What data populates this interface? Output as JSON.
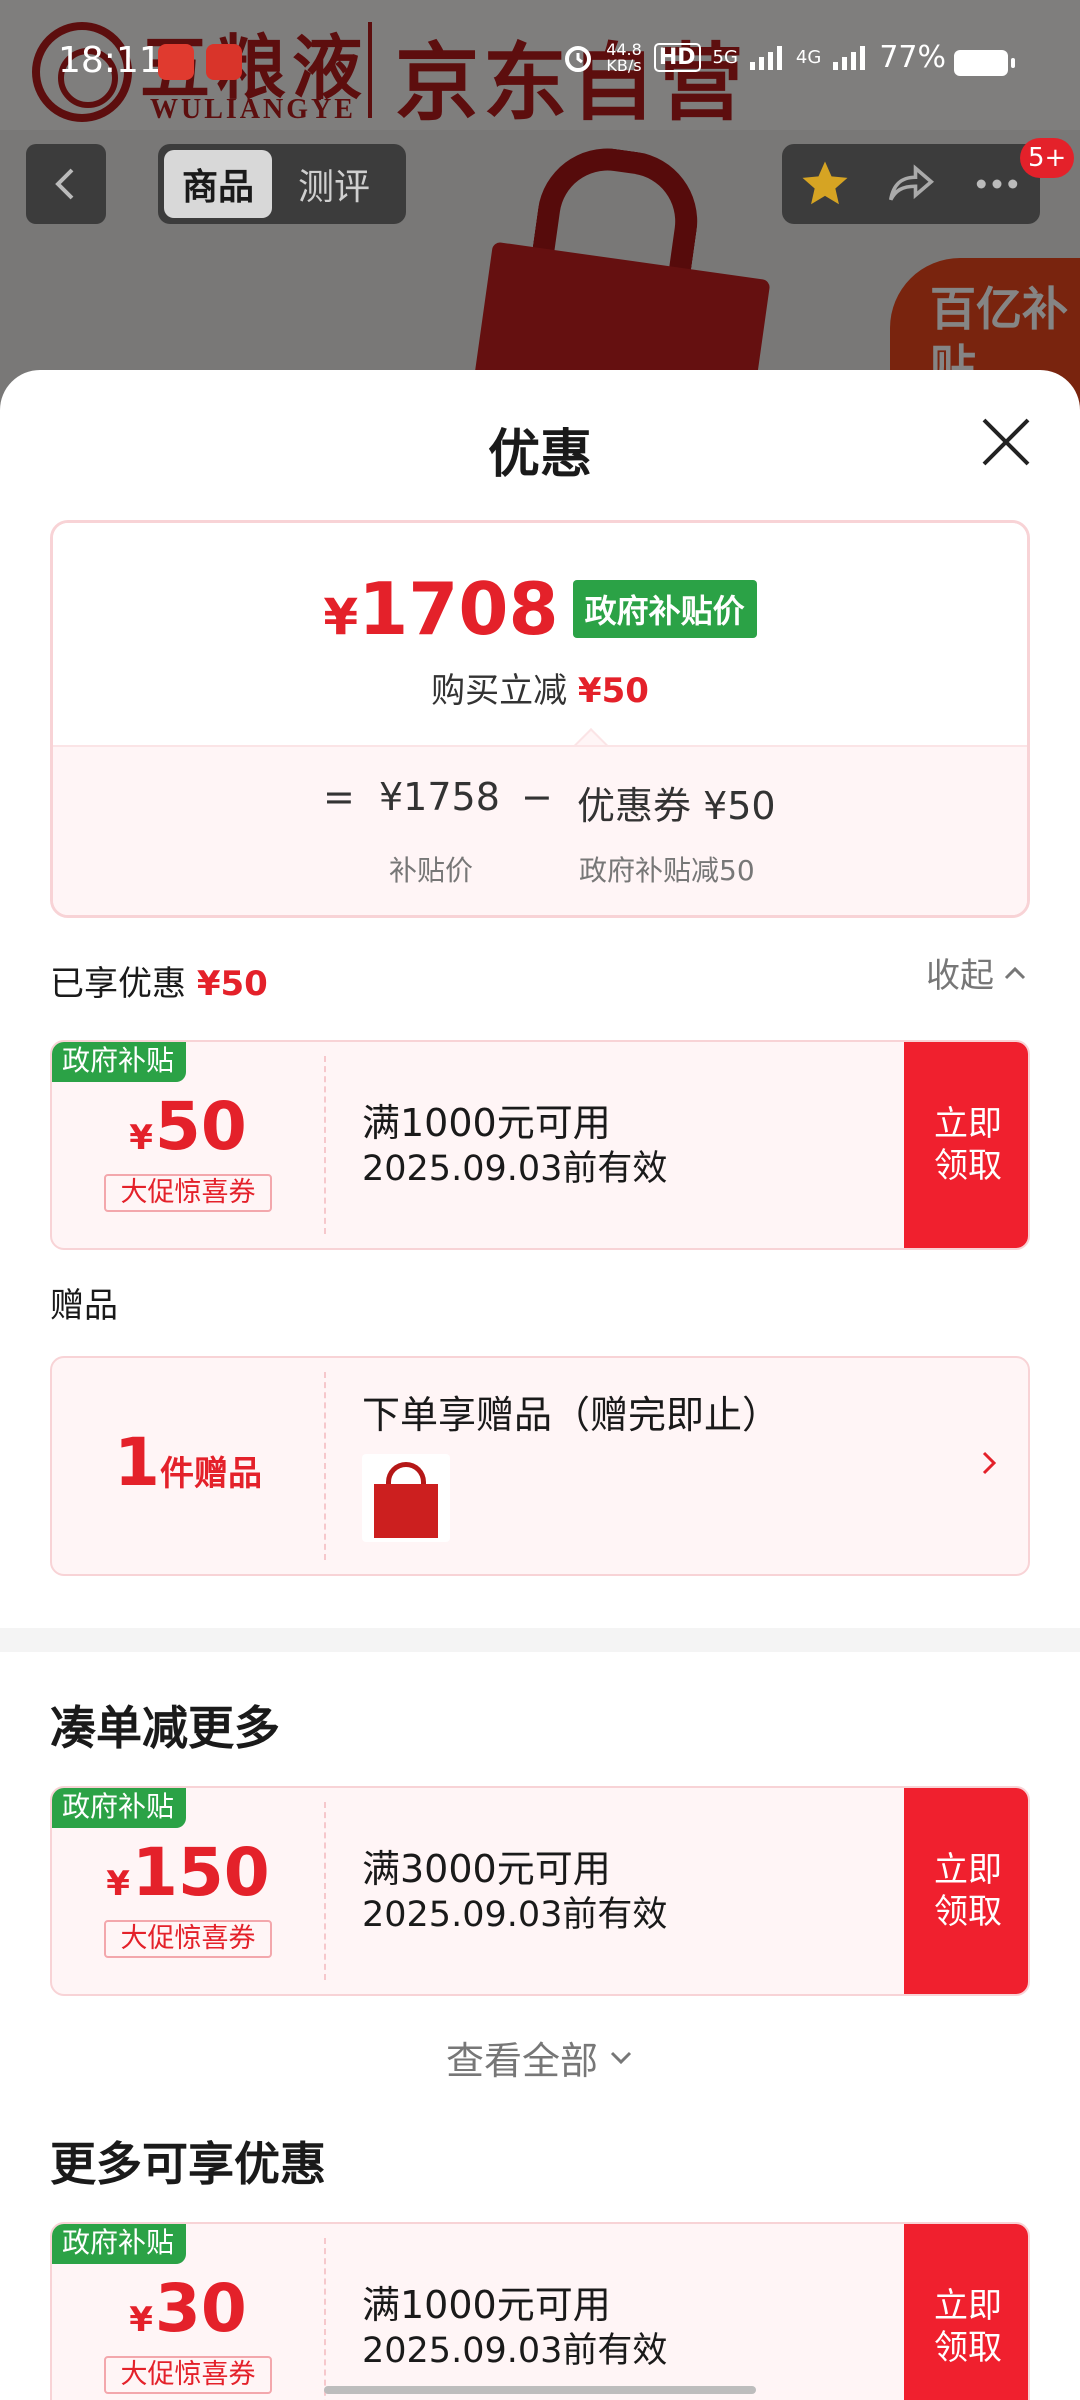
{
  "status_bar": {
    "time": "18:11",
    "net_speed_value": "44.8",
    "net_speed_unit": "KB/s",
    "hd": "HD",
    "sim1": "5G",
    "sim2": "4G",
    "battery": "77%",
    "battery_level": 0.77
  },
  "background": {
    "brand_cn": "五粮液",
    "brand_en": "WULIANGYE",
    "jd_text": "京东自营",
    "badge_text": "百亿补贴"
  },
  "nav": {
    "tabs": [
      {
        "label": "商品",
        "active": true
      },
      {
        "label": "测评",
        "active": false
      }
    ],
    "more_badge": "5+"
  },
  "sheet": {
    "title": "优惠",
    "price": {
      "currency": "¥",
      "amount": "1708",
      "tag": "政府补贴价",
      "sub_label": "购买立减",
      "sub_value": "¥50",
      "equals": "=",
      "base_value": "¥1758",
      "base_label": "补贴价",
      "minus": "−",
      "coupon_value": "优惠券 ¥50",
      "coupon_label": "政府补贴减50"
    },
    "enjoyed": {
      "label": "已享优惠",
      "value": "¥50",
      "collapse": "收起"
    },
    "gifts_label": "赠品",
    "gift": {
      "count": "1",
      "unit": "件赠品",
      "title": "下单享赠品（赠完即止）"
    },
    "more_title": "凑单减更多",
    "view_all": "查看全部",
    "extra_title": "更多可享优惠",
    "coupons": [
      {
        "tag": "政府补贴",
        "currency": "¥",
        "amount": "50",
        "type": "大促惊喜券",
        "condition": "满1000元可用",
        "valid": "2025.09.03前有效",
        "button": "立即领取"
      },
      {
        "tag": "政府补贴",
        "currency": "¥",
        "amount": "150",
        "type": "大促惊喜券",
        "condition": "满3000元可用",
        "valid": "2025.09.03前有效",
        "button": "立即领取"
      },
      {
        "tag": "政府补贴",
        "currency": "¥",
        "amount": "30",
        "type": "大促惊喜券",
        "condition": "满1000元可用",
        "valid": "2025.09.03前有效",
        "button": "立即领取"
      }
    ]
  },
  "colors": {
    "accent_red": "#e4212a",
    "button_red": "#f0202e",
    "gov_green": "#2ba246",
    "card_bg": "#fff5f6",
    "card_border": "#f8d3d6"
  }
}
